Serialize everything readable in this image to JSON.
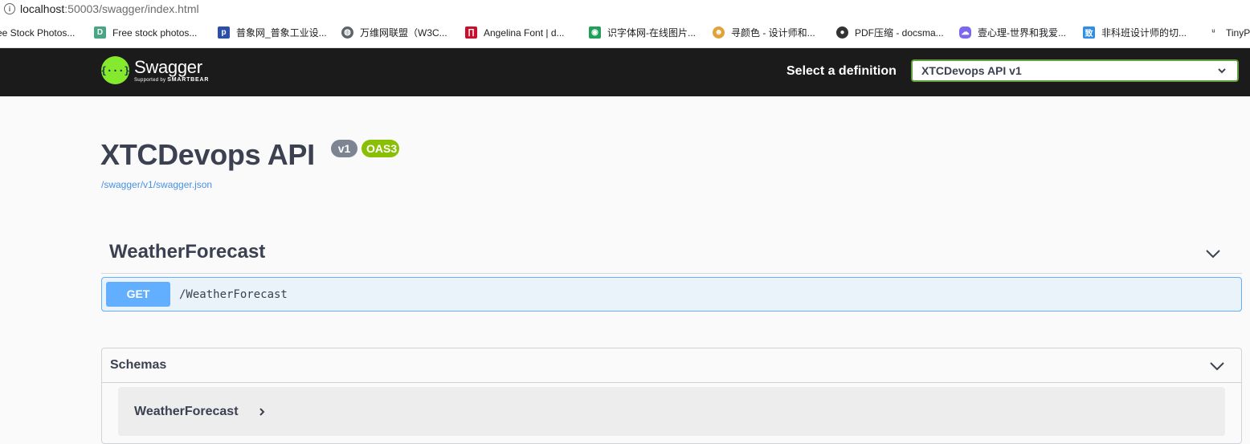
{
  "browser": {
    "url_host": "localhost",
    "url_path": ":50003/swagger/index.html"
  },
  "bookmarks": [
    {
      "label": "ee Stock Photos...",
      "icon": "none"
    },
    {
      "label": "Free stock photos...",
      "icon": "d-icon",
      "color": "#4aa584"
    },
    {
      "label": "普象网_普象工业设...",
      "icon": "p-icon",
      "color": "#2b4fa8"
    },
    {
      "label": "万维网联盟（W3C...",
      "icon": "globe-icon",
      "color": "#5f6368"
    },
    {
      "label": "Angelina Font | d...",
      "icon": "font-icon",
      "color": "#c8102e"
    },
    {
      "label": "识字体网-在线图片...",
      "icon": "eye-icon",
      "color": "#22a05a"
    },
    {
      "label": "寻颜色 - 设计师和...",
      "icon": "color-icon",
      "color": "#e2a23b"
    },
    {
      "label": "PDF压缩 - docsma...",
      "icon": "circle-icon",
      "color": "#333333"
    },
    {
      "label": "壹心理-世界和我爱...",
      "icon": "cloud-icon",
      "color": "#7b68ee"
    },
    {
      "label": "非科班设计师的切...",
      "icon": "zhi-icon",
      "color": "#2e8ee6"
    },
    {
      "label": "TinyP",
      "icon": "panda-icon",
      "color": "#4a4a4a"
    }
  ],
  "topbar": {
    "logo_title": "Swagger",
    "logo_sub_prefix": "Supported by",
    "logo_sub_brand": "SMARTBEAR",
    "select_label": "Select a definition",
    "selected_definition": "XTCDevops API v1"
  },
  "info": {
    "title": "XTCDevops API",
    "version": "v1",
    "oas": "OAS3",
    "spec_url": "/swagger/v1/swagger.json"
  },
  "tag": {
    "name": "WeatherForecast",
    "operation": {
      "method": "GET",
      "path": "/WeatherForecast"
    }
  },
  "schemas": {
    "title": "Schemas",
    "models": [
      "WeatherForecast"
    ]
  },
  "colors": {
    "get": "#61affe",
    "oas": "#89bf04",
    "topbar": "#1b1b1b",
    "accent": "#62a03f"
  }
}
